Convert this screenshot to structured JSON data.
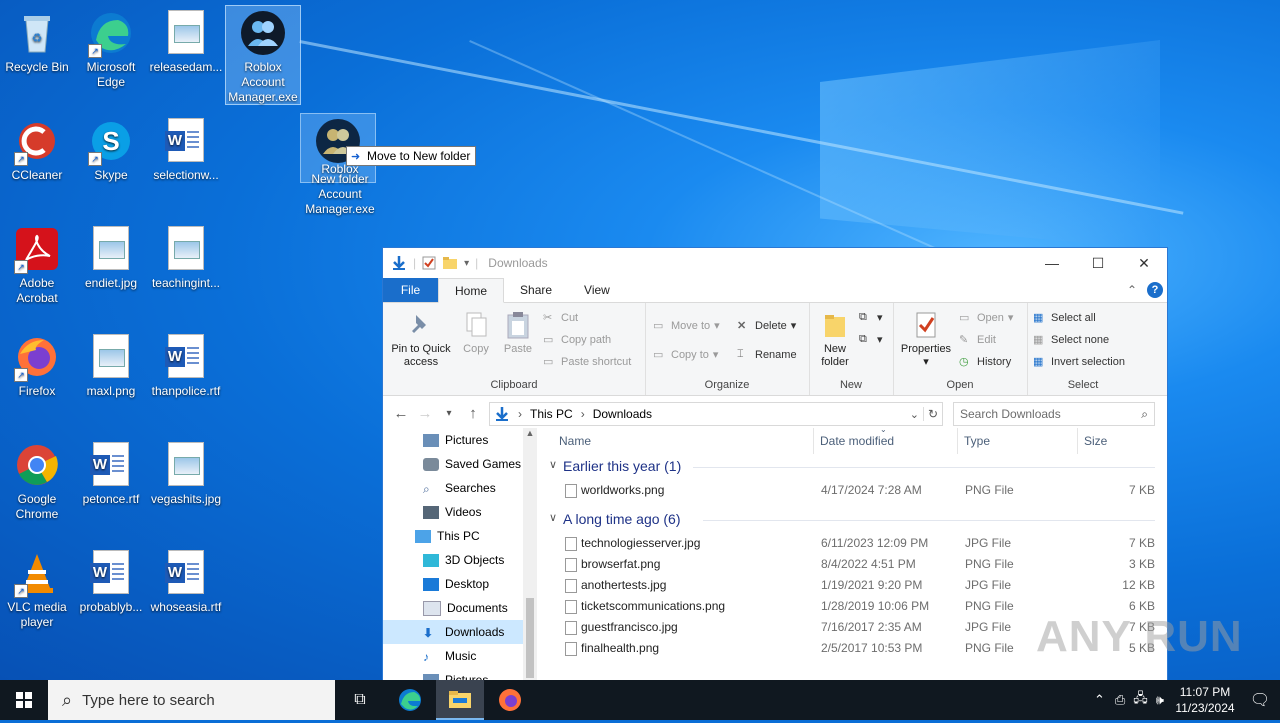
{
  "desktop": {
    "icons": [
      {
        "label": "Recycle Bin"
      },
      {
        "label": "Microsoft Edge"
      },
      {
        "label": "releasedam..."
      },
      {
        "label": "Roblox Account Manager.exe"
      },
      {
        "label": "CCleaner"
      },
      {
        "label": "Skype"
      },
      {
        "label": "selectionw..."
      },
      {
        "label": "Adobe Acrobat"
      },
      {
        "label": "endiet.jpg"
      },
      {
        "label": "teachingint..."
      },
      {
        "label": "Firefox"
      },
      {
        "label": "maxl.png"
      },
      {
        "label": "thanpolice.rtf"
      },
      {
        "label": "Google Chrome"
      },
      {
        "label": "petonce.rtf"
      },
      {
        "label": "vegashits.jpg"
      },
      {
        "label": "VLC media player"
      },
      {
        "label": "probablyb..."
      },
      {
        "label": "whoseasia.rtf"
      }
    ],
    "drag_ghost": {
      "label_top": "Roblox",
      "label_mid": "New folder",
      "label_rest": "Account Manager.exe"
    },
    "drag_tooltip": "Move to New folder"
  },
  "explorer": {
    "title": "Downloads",
    "tabs": {
      "file": "File",
      "home": "Home",
      "share": "Share",
      "view": "View"
    },
    "ribbon": {
      "clipboard": {
        "pin": "Pin to Quick access",
        "copy": "Copy",
        "paste": "Paste",
        "cut": "Cut",
        "copy_path": "Copy path",
        "paste_shortcut": "Paste shortcut",
        "label": "Clipboard"
      },
      "organize": {
        "move_to": "Move to",
        "copy_to": "Copy to",
        "delete": "Delete",
        "rename": "Rename",
        "label": "Organize"
      },
      "new": {
        "new_folder": "New folder",
        "label": "New"
      },
      "open": {
        "properties": "Properties",
        "open": "Open",
        "edit": "Edit",
        "history": "History",
        "label": "Open"
      },
      "select": {
        "select_all": "Select all",
        "select_none": "Select none",
        "invert": "Invert selection",
        "label": "Select"
      }
    },
    "address": {
      "this_pc": "This PC",
      "downloads": "Downloads"
    },
    "search_placeholder": "Search Downloads",
    "nav": [
      {
        "label": "Pictures"
      },
      {
        "label": "Saved Games"
      },
      {
        "label": "Searches"
      },
      {
        "label": "Videos"
      },
      {
        "label": "This PC"
      },
      {
        "label": "3D Objects"
      },
      {
        "label": "Desktop"
      },
      {
        "label": "Documents"
      },
      {
        "label": "Downloads"
      },
      {
        "label": "Music"
      },
      {
        "label": "Pictures"
      }
    ],
    "columns": {
      "name": "Name",
      "date": "Date modified",
      "type": "Type",
      "size": "Size"
    },
    "groups": [
      {
        "label": "Earlier this year (1)",
        "files": [
          {
            "name": "worldworks.png",
            "date": "4/17/2024 7:28 AM",
            "type": "PNG File",
            "size": "7 KB"
          }
        ]
      },
      {
        "label": "A long time ago (6)",
        "files": [
          {
            "name": "technologiesserver.jpg",
            "date": "6/11/2023 12:09 PM",
            "type": "JPG File",
            "size": "7 KB"
          },
          {
            "name": "browserfat.png",
            "date": "8/4/2022 4:51 PM",
            "type": "PNG File",
            "size": "3 KB"
          },
          {
            "name": "anothertests.jpg",
            "date": "1/19/2021 9:20 PM",
            "type": "JPG File",
            "size": "12 KB"
          },
          {
            "name": "ticketscommunications.png",
            "date": "1/28/2019 10:06 PM",
            "type": "PNG File",
            "size": "6 KB"
          },
          {
            "name": "guestfrancisco.jpg",
            "date": "7/16/2017 2:35 AM",
            "type": "JPG File",
            "size": "7 KB"
          },
          {
            "name": "finalhealth.png",
            "date": "2/5/2017 10:53 PM",
            "type": "PNG File",
            "size": "5 KB"
          }
        ]
      }
    ]
  },
  "taskbar": {
    "search_placeholder": "Type here to search",
    "time": "11:07 PM",
    "date": "11/23/2024"
  },
  "watermark": "ANY RUN",
  "colors": {
    "accent": "#1a6ecb",
    "group_header": "#1e3287",
    "nav_selected": "#cce8ff",
    "taskbar": "#101820"
  }
}
